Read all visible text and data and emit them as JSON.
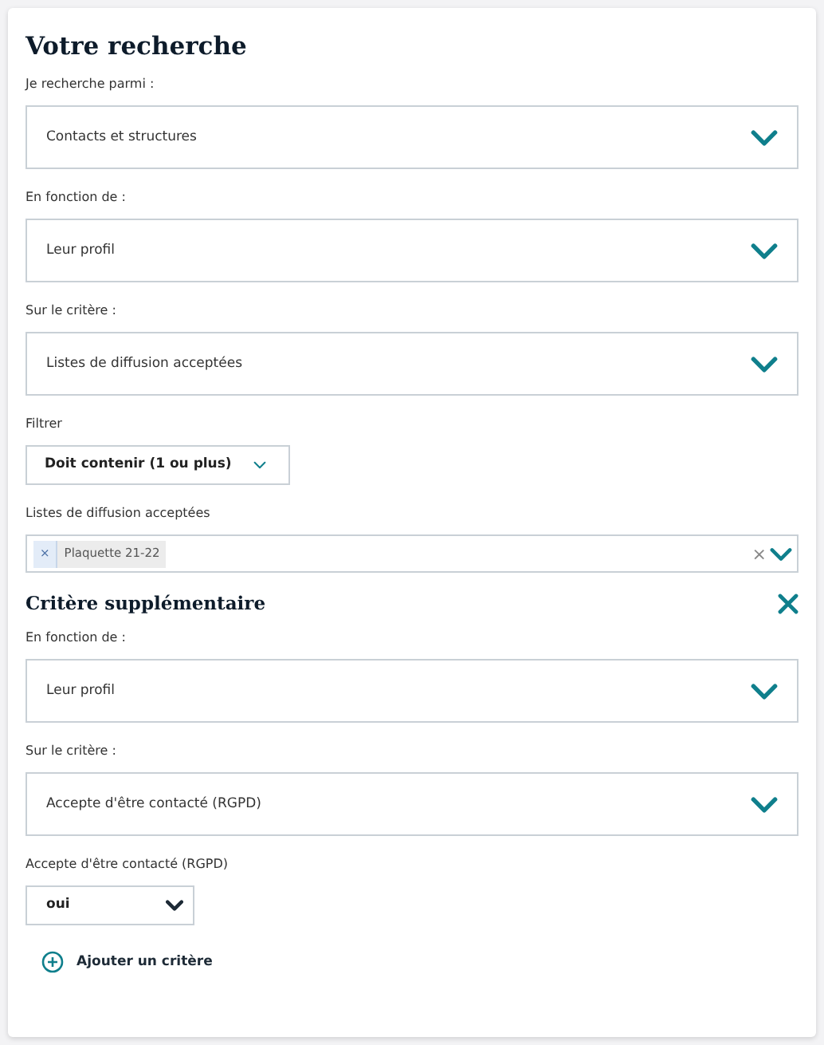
{
  "title": "Votre recherche",
  "fields": [
    {
      "kind": "large",
      "label": "Je recherche parmi :",
      "value": "Contacts et structures"
    },
    {
      "kind": "large",
      "label": "En fonction de :",
      "value": "Leur profil"
    },
    {
      "kind": "large",
      "label": "Sur le critère :",
      "value": "Listes de diffusion acceptées"
    },
    {
      "kind": "compact",
      "label": "Filtrer",
      "value": "Doit contenir (1 ou plus)"
    },
    {
      "kind": "multi",
      "label": "Listes de diffusion acceptées",
      "tags": [
        {
          "remove": "×",
          "text": "Plaquette 21-22"
        }
      ],
      "clear": "×"
    }
  ],
  "extra_criterion": {
    "title": "Critère supplémentaire",
    "fields": [
      {
        "kind": "large",
        "label": "En fonction de :",
        "value": "Leur profil"
      },
      {
        "kind": "large",
        "label": "Sur le critère :",
        "value": "Accepte d'être contacté (RGPD)"
      },
      {
        "kind": "small",
        "label": "Accepte d'être contacté (RGPD)",
        "value": "oui"
      }
    ]
  },
  "add_button": "Ajouter un critère"
}
